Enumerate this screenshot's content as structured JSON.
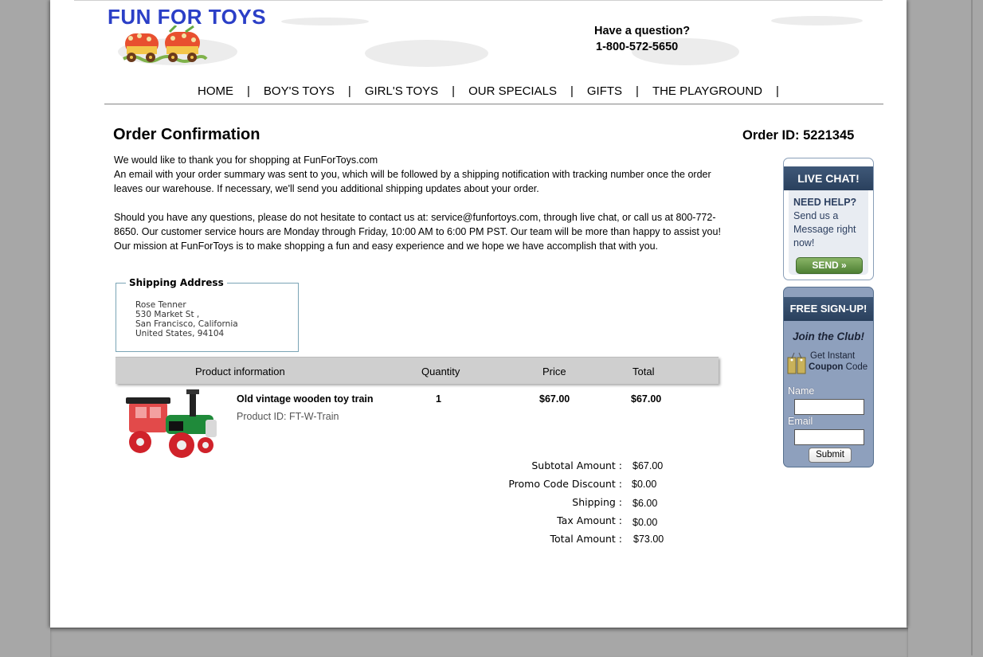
{
  "header": {
    "logo_text": "FUN FOR TOYS",
    "question": "Have a question?",
    "phone": "1-800-572-5650"
  },
  "nav": {
    "items": [
      "HOME",
      "BOY'S TOYS",
      "GIRL'S TOYS",
      "OUR SPECIALS",
      "GIFTS",
      "THE PLAYGROUND"
    ],
    "separator": "|"
  },
  "order": {
    "title": "Order Confirmation",
    "order_id": "Order ID: 5221345",
    "message_lines": [
      "We would like to thank you for shopping at FunForToys.com",
      "An email with your order summary was sent to you, which will be followed by a shipping notification with tracking number once the order leaves our warehouse. If necessary, we'll send you additional shipping updates about your order.",
      "Should you have any questions, please do not hesitate to contact us at: service@funfortoys.com, through live chat, or call us at 800-772-8650. Our customer service hours are Monday through Friday, 10:00 AM to 6:00 PM PST. Our team will be more than happy to assist you! Our mission at FunForToys is to make shopping a fun  and easy experience and we hope we have accomplish that with you."
    ]
  },
  "shipping": {
    "title": "Shipping Address",
    "lines": [
      "Rose Tenner",
      "530 Market St ,",
      "San Francisco, California",
      "United States, 94104"
    ]
  },
  "table": {
    "headers": [
      "Product information",
      "Quantity",
      "Price",
      "Total"
    ],
    "product": {
      "name": "Old vintage wooden toy train",
      "id": "Product ID: FT-W-Train",
      "quantity": "1",
      "price": "$67.00",
      "total": "$67.00",
      "image_icon": "toy-train-image"
    }
  },
  "summary": {
    "rows": [
      {
        "label": "Subtotal Amount :",
        "value": "$67.00"
      },
      {
        "label": "Promo Code Discount :",
        "value": "$0.00"
      },
      {
        "label": "Shipping :",
        "value": "$6.00"
      },
      {
        "label": "Tax Amount :",
        "value": "$0.00"
      },
      {
        "label": "Total Amount :",
        "value": "$73.00"
      }
    ]
  },
  "live_chat": {
    "banner": "LIVE CHAT!",
    "need_help": "NEED HELP?",
    "text": "Send us a Message right now!",
    "send": "SEND"
  },
  "signup": {
    "banner": "FREE SIGN-UP!",
    "join": "Join the Club!",
    "coupon_line1": "Get Instant",
    "coupon_bold": "Coupon",
    "coupon_rest": " Code",
    "name_label": "Name",
    "email_label": "Email",
    "submit": "Submit"
  },
  "colors": {
    "logo": "#2b3fc7",
    "widget_banner": "#2a405d",
    "signup_bg": "#8ea0bd",
    "send_button": "#5c8c3e",
    "page_bg": "#a7a7a7"
  }
}
